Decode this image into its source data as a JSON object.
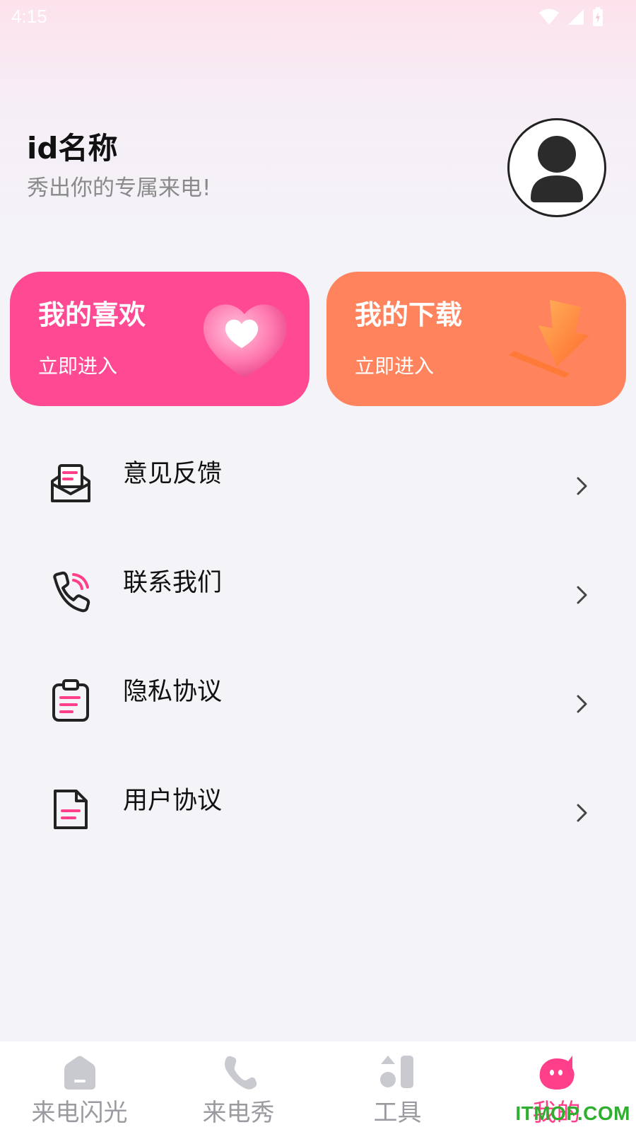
{
  "status_bar": {
    "time": "4:15",
    "icons": [
      "wifi-icon",
      "cellular-signal-icon",
      "battery-charging-icon"
    ]
  },
  "profile": {
    "name": "id名称",
    "slogan": "秀出你的专属来电!",
    "avatar_icon": "user-avatar-icon"
  },
  "cards": [
    {
      "title": "我的喜欢",
      "subtitle": "立即进入",
      "icon": "heart-icon",
      "color": "#ff4a93"
    },
    {
      "title": "我的下载",
      "subtitle": "立即进入",
      "icon": "download-arrow-icon",
      "color": "#ff845e"
    }
  ],
  "menu": [
    {
      "label": "意见反馈",
      "icon": "feedback-envelope-icon"
    },
    {
      "label": "联系我们",
      "icon": "phone-call-icon"
    },
    {
      "label": "隐私协议",
      "icon": "clipboard-icon"
    },
    {
      "label": "用户协议",
      "icon": "document-icon"
    }
  ],
  "tabbar": {
    "tabs": [
      {
        "label": "来电闪光",
        "icon": "flash-screen-icon",
        "active": false
      },
      {
        "label": "来电秀",
        "icon": "phone-icon",
        "active": false
      },
      {
        "label": "工具",
        "icon": "tools-icon",
        "active": false
      },
      {
        "label": "我的",
        "icon": "mine-face-icon",
        "active": true
      }
    ]
  },
  "colors": {
    "accent": "#ff3f8a",
    "inactive": "#9a9ba0",
    "background": "#f4f3f8"
  },
  "watermark": "ITMOP.COM"
}
